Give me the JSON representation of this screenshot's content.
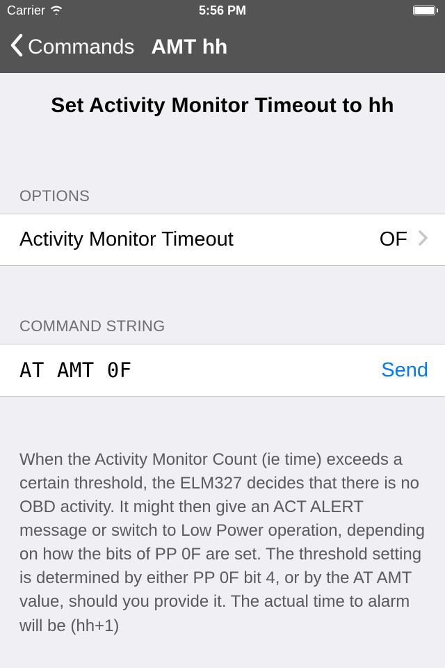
{
  "status": {
    "carrier": "Carrier",
    "time": "5:56 PM"
  },
  "nav": {
    "back_label": "Commands",
    "title": "AMT hh"
  },
  "page_title": "Set Activity Monitor Timeout to hh",
  "sections": {
    "options": {
      "header": "OPTIONS",
      "row": {
        "label": "Activity Monitor Timeout",
        "value": "OF"
      }
    },
    "command": {
      "header": "COMMAND STRING",
      "value": "AT AMT 0F",
      "send_label": "Send"
    }
  },
  "description": "When the Activity Monitor Count (ie time) exceeds a certain threshold, the ELM327 decides that there is no OBD activity. It might then give an ACT ALERT message or switch to Low Power operation, depending on how the bits of PP 0F are set. The threshold setting is determined by either PP 0F bit 4, or by the AT AMT value, should you provide it. The actual time to alarm will be (hh+1)"
}
